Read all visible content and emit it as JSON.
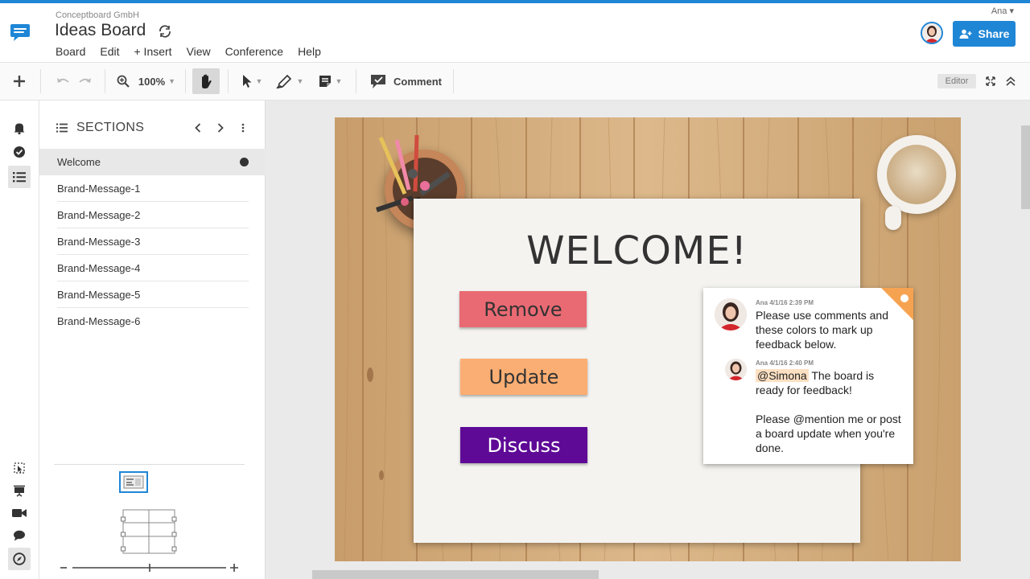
{
  "header": {
    "company": "Conceptboard GmbH",
    "title": "Ideas Board",
    "user_name": "Ana ▾",
    "share_label": "Share",
    "menu": [
      "Board",
      "Edit",
      "+ Insert",
      "View",
      "Conference",
      "Help"
    ]
  },
  "toolbar": {
    "zoom": "100%",
    "comment_label": "Comment",
    "editor_badge": "Editor"
  },
  "sections": {
    "title": "SECTIONS",
    "items": [
      "Welcome",
      "Brand-Message-1",
      "Brand-Message-2",
      "Brand-Message-3",
      "Brand-Message-4",
      "Brand-Message-5",
      "Brand-Message-6"
    ],
    "active_index": 0
  },
  "board": {
    "heading": "WELCOME!",
    "buttons": {
      "remove": "Remove",
      "update": "Update",
      "discuss": "Discuss"
    },
    "colors": {
      "remove": "#e96a73",
      "update": "#fbae73",
      "discuss": "#5e0a96"
    },
    "comments": [
      {
        "meta": "Ana 4/1/16 2:39 PM",
        "lines": [
          "Please use comments and",
          "these colors to mark up",
          "feedback below."
        ]
      },
      {
        "meta": "Ana 4/1/16 2:40 PM",
        "mention": "@Simona",
        "line1_rest": " The board is",
        "lines": [
          "ready for feedback!",
          "",
          "Please @mention me or post",
          "a board update when you're",
          "done."
        ]
      }
    ]
  },
  "colors": {
    "accent": "#1f86d6"
  }
}
